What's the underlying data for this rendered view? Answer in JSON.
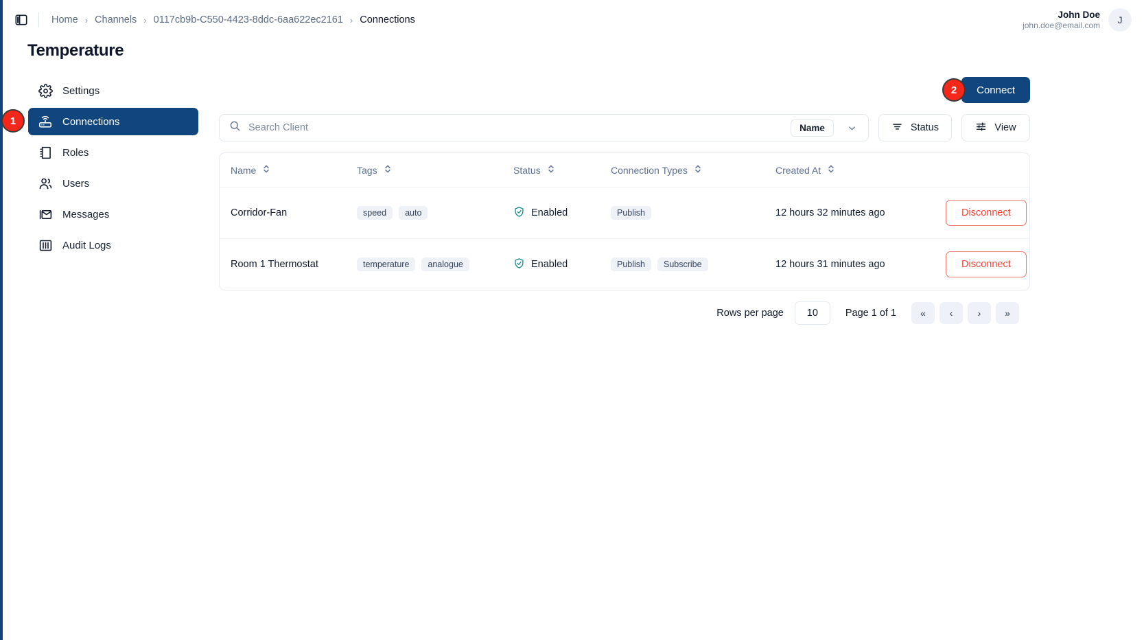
{
  "topbar": {
    "panel_toggle_icon": "sidebar-panel-icon",
    "breadcrumbs": [
      {
        "label": "Home",
        "current": false
      },
      {
        "label": "Channels",
        "current": false
      },
      {
        "label": "0117cb9b-C550-4423-8ddc-6aa622ec2161",
        "current": false
      },
      {
        "label": "Connections",
        "current": true
      }
    ],
    "separator": "›",
    "user": {
      "name": "John Doe",
      "email": "john.doe@email.com",
      "avatar_initial": "J"
    }
  },
  "page": {
    "title": "Temperature"
  },
  "sidebar": {
    "items": [
      {
        "label": "Settings",
        "icon": "gear-icon",
        "active": false
      },
      {
        "label": "Connections",
        "icon": "router-icon",
        "active": true
      },
      {
        "label": "Roles",
        "icon": "book-icon",
        "active": false
      },
      {
        "label": "Users",
        "icon": "users-icon",
        "active": false
      },
      {
        "label": "Messages",
        "icon": "envelope-icon",
        "active": false
      },
      {
        "label": "Audit Logs",
        "icon": "columns-icon",
        "active": false
      }
    ]
  },
  "step_badges": [
    {
      "number": "1"
    },
    {
      "number": "2"
    }
  ],
  "toolbar": {
    "connect_label": "Connect",
    "search_placeholder": "Search Client",
    "search_value": "",
    "search_icon": "search-icon",
    "field_pill_label": "Name",
    "chevron_icon": "chevron-down-icon",
    "status_label": "Status",
    "status_icon": "filter-icon",
    "view_label": "View",
    "view_icon": "sliders-icon"
  },
  "table": {
    "columns": [
      {
        "label": "Name",
        "sortable": true
      },
      {
        "label": "Tags",
        "sortable": true
      },
      {
        "label": "Status",
        "sortable": true
      },
      {
        "label": "Connection Types",
        "sortable": true
      },
      {
        "label": "Created At",
        "sortable": true
      },
      {
        "label": "",
        "sortable": false
      }
    ],
    "rows": [
      {
        "name": "Corridor-Fan",
        "tags": [
          "speed",
          "auto"
        ],
        "status": "Enabled",
        "status_icon": "shield-check-icon",
        "connection_types": [
          "Publish"
        ],
        "created_at": "12 hours 32 minutes ago",
        "action_label": "Disconnect"
      },
      {
        "name": "Room 1 Thermostat",
        "tags": [
          "temperature",
          "analogue"
        ],
        "status": "Enabled",
        "status_icon": "shield-check-icon",
        "connection_types": [
          "Publish",
          "Subscribe"
        ],
        "created_at": "12 hours 31 minutes ago",
        "action_label": "Disconnect"
      }
    ]
  },
  "pagination": {
    "rows_per_page_label": "Rows per page",
    "rows_per_page_value": "10",
    "page_label": "Page 1 of 1",
    "first_icon": "«",
    "prev_icon": "‹",
    "next_icon": "›",
    "last_icon": "»"
  },
  "colors": {
    "brand": "#11457e",
    "danger": "#f04438",
    "badge": "#f5271b",
    "status_ok": "#0f8a8a",
    "muted": "#5b7091"
  }
}
